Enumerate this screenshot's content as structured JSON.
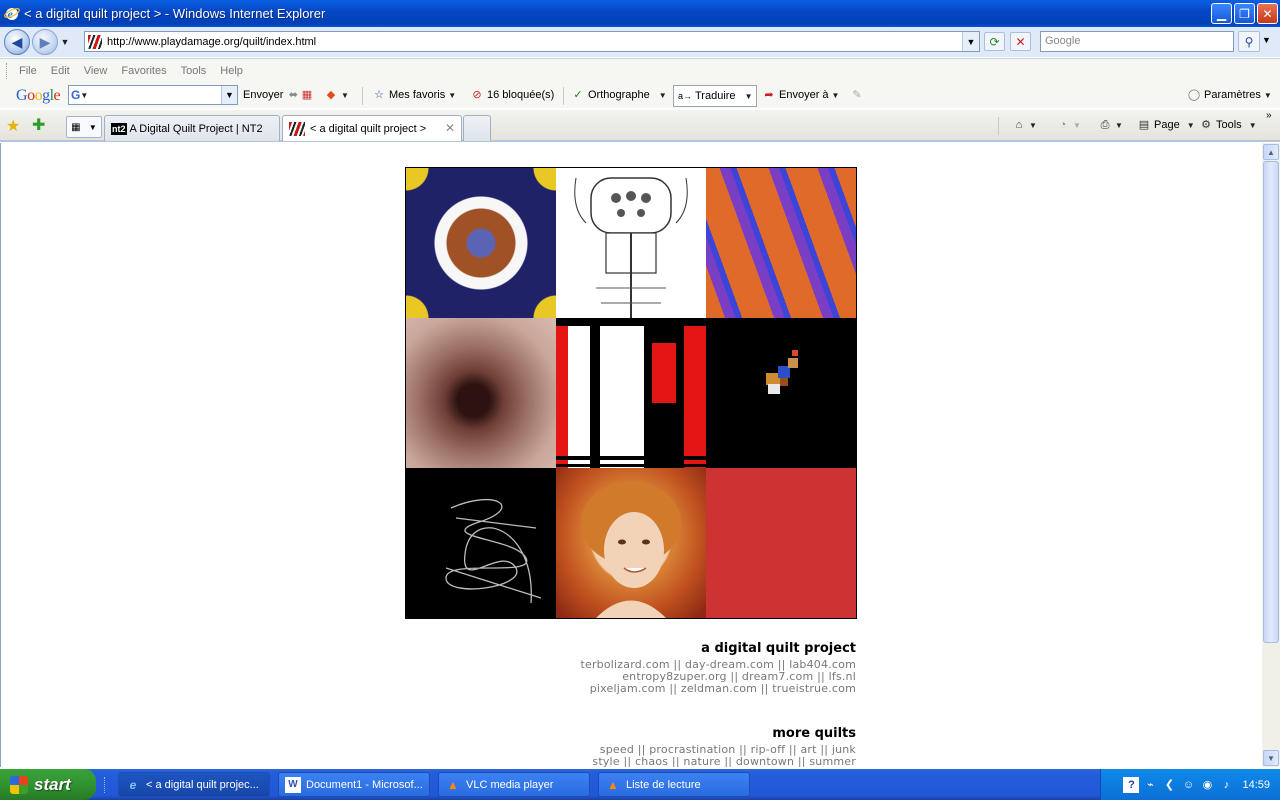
{
  "window": {
    "title": "< a digital quilt project > - Windows Internet Explorer"
  },
  "address": {
    "url": "http://www.playdamage.org/quilt/index.html",
    "search_placeholder": "Google"
  },
  "menu": {
    "items": [
      "File",
      "Edit",
      "View",
      "Favorites",
      "Tools",
      "Help"
    ]
  },
  "google_toolbar": {
    "logo": "Google",
    "search_icon_letter": "G",
    "send": "Envoyer",
    "bookmarks": "Mes favoris",
    "blocked": "16 bloquée(s)",
    "spelling": "Orthographe",
    "translate": "Traduire",
    "send_to": "Envoyer à",
    "settings": "Paramètres"
  },
  "tabs": {
    "items": [
      {
        "label": "A Digital Quilt Project | NT2",
        "badge": "nt2",
        "active": false
      },
      {
        "label": "< a digital quilt project >",
        "active": true
      }
    ],
    "page_label": "Page",
    "tools_label": "Tools"
  },
  "page": {
    "quilt_section": {
      "heading": "a digital quilt project",
      "lines": [
        "terbolizard.com || day-dream.com || lab404.com",
        "entropy8zuper.org || dream7.com || lfs.nl",
        "pixeljam.com || zeldman.com || trueistrue.com"
      ]
    },
    "more_section": {
      "heading": "more quilts",
      "lines": [
        "speed || procrastination || rip-off || art || junk",
        "style || chaos || nature || downtown || summer"
      ]
    }
  },
  "taskbar": {
    "start": "start",
    "tasks": [
      "< a digital quilt projec...",
      "Document1 - Microsof...",
      "VLC media player",
      "Liste de lecture"
    ],
    "clock": "14:59"
  },
  "colors": {
    "titlebar": "#0448c8",
    "taskbar": "#245edb",
    "start_button": "#2f8f2f",
    "quilt_red": "#cd3333"
  }
}
